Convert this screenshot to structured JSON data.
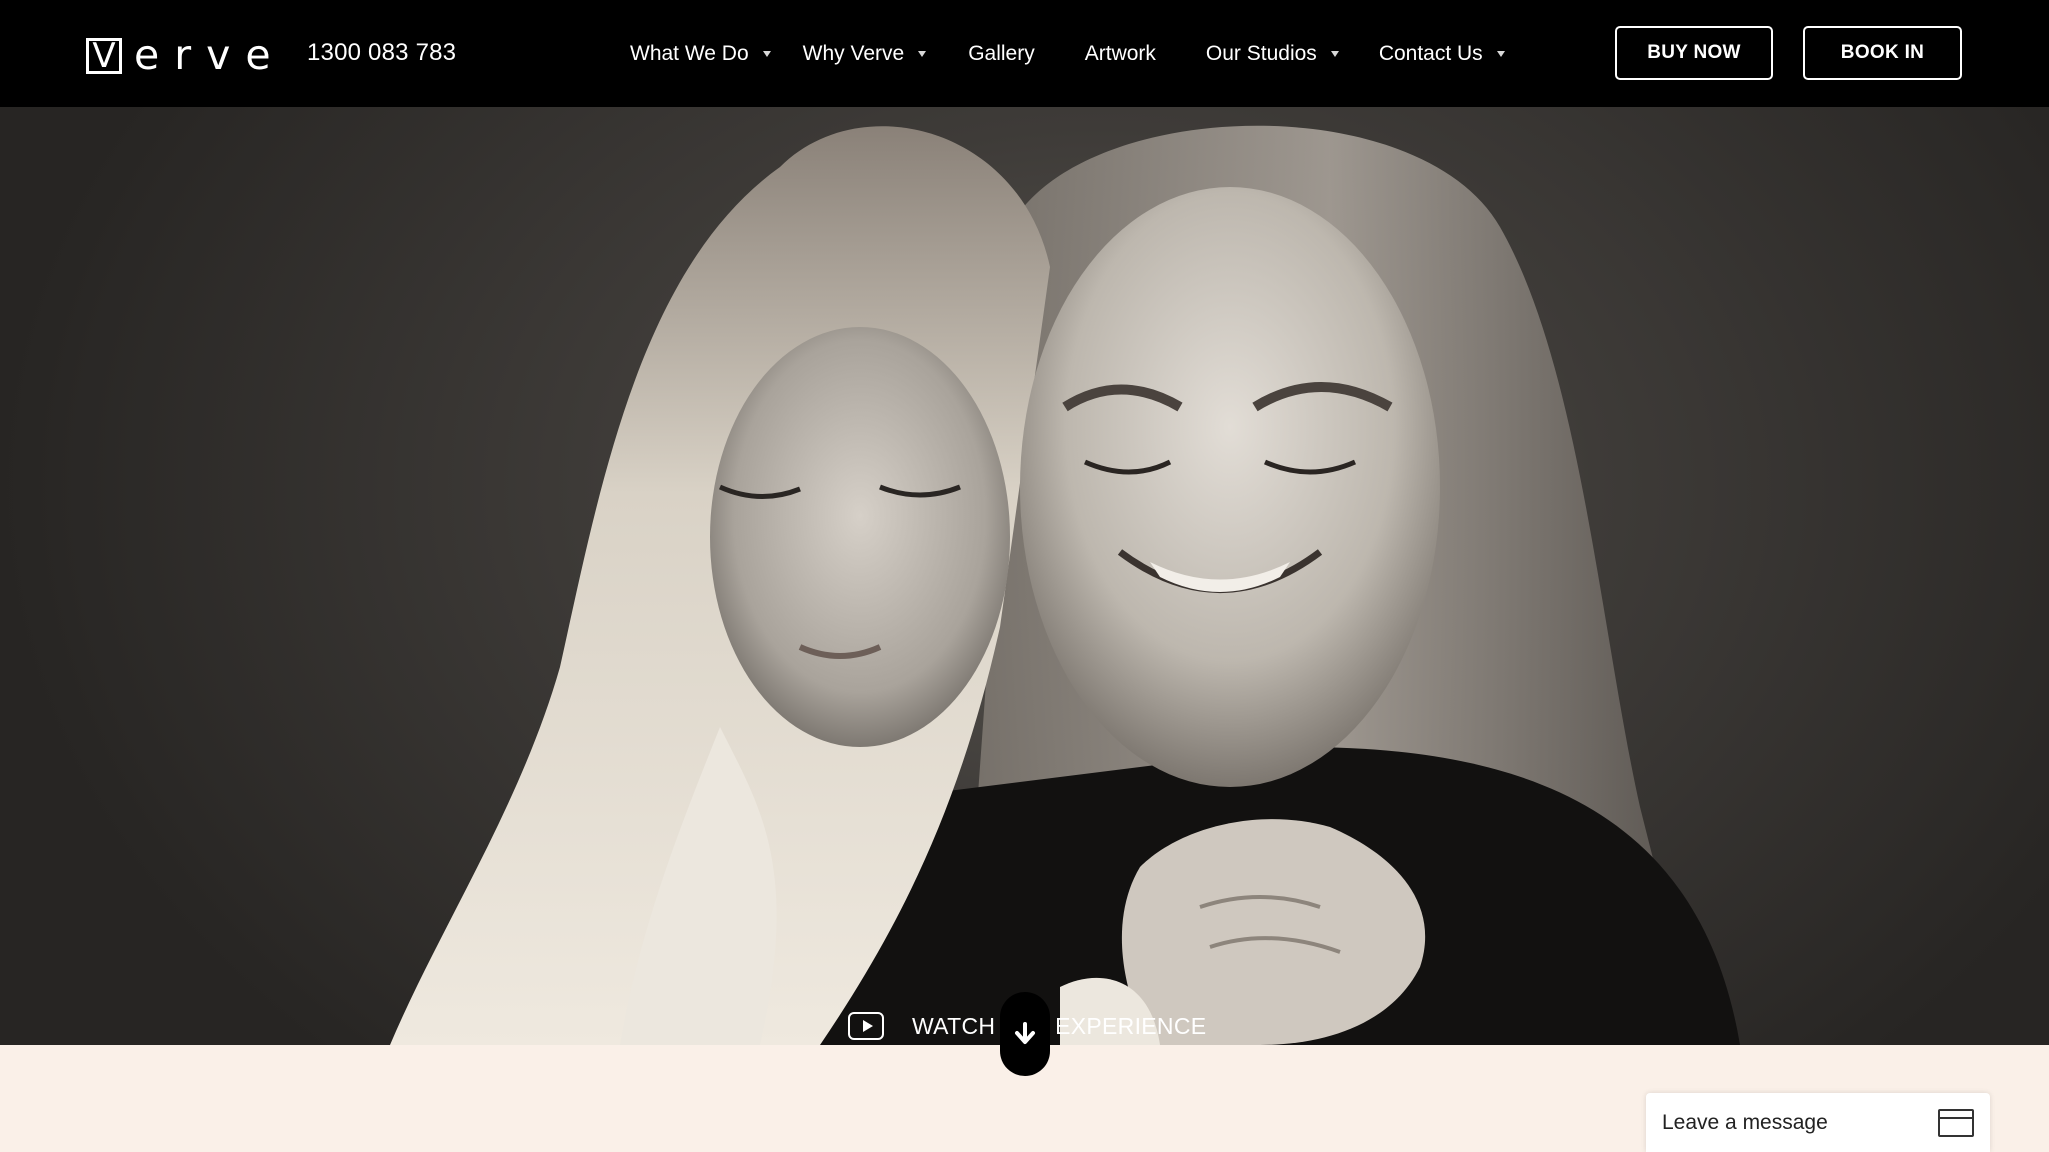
{
  "header": {
    "logo_initial": "V",
    "logo_rest": "erve",
    "phone": "1300 083 783",
    "nav": [
      {
        "label": "What We Do",
        "has_dropdown": true
      },
      {
        "label": "Why Verve",
        "has_dropdown": true
      },
      {
        "label": "Gallery",
        "has_dropdown": false
      },
      {
        "label": "Artwork",
        "has_dropdown": false
      },
      {
        "label": "Our Studios",
        "has_dropdown": true
      },
      {
        "label": "Contact Us",
        "has_dropdown": true
      }
    ],
    "buy_label": "BUY NOW",
    "book_label": "BOOK IN"
  },
  "hero": {
    "watch_label": "WATCH THE EXPERIENCE",
    "play_icon": "play-icon",
    "scroll_icon": "arrow-down-icon"
  },
  "chat": {
    "label": "Leave a message",
    "icon": "chat-window-icon"
  },
  "colors": {
    "header_bg": "#000000",
    "section_bg": "#faf0e8",
    "text_light": "#ffffff"
  }
}
